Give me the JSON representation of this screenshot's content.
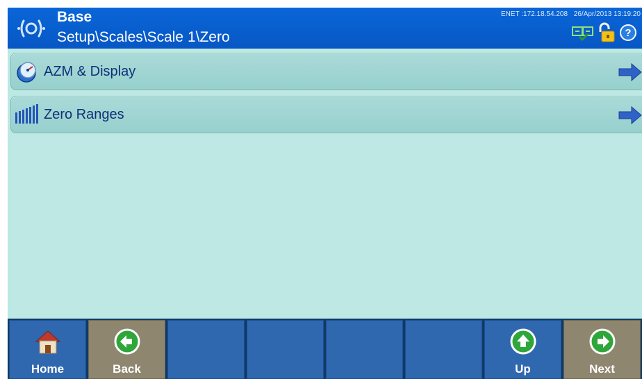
{
  "header": {
    "title": "Base",
    "path": "Setup\\Scales\\Scale 1\\Zero",
    "network": "ENET :172.18.54.208",
    "datetime": "26/Apr/2013 13:19:20",
    "icons": [
      "scale-status-icon",
      "unlock-icon",
      "help-icon"
    ]
  },
  "menu": {
    "items": [
      {
        "label": "AZM & Display",
        "icon": "azm-display-icon"
      },
      {
        "label": "Zero Ranges",
        "icon": "zero-ranges-icon"
      }
    ]
  },
  "softkeys": [
    {
      "label": "Home",
      "icon": "home-icon"
    },
    {
      "label": "Back",
      "icon": "back-arrow-icon"
    },
    {
      "label": ""
    },
    {
      "label": ""
    },
    {
      "label": ""
    },
    {
      "label": ""
    },
    {
      "label": "Up",
      "icon": "up-arrow-icon"
    },
    {
      "label": "Next",
      "icon": "next-arrow-icon"
    }
  ],
  "colors": {
    "header": "#0a66d8",
    "content": "#bde8e4",
    "menu_item": "#a9dad8",
    "softkey_blue": "#3068b0",
    "softkey_tan": "#8f8670",
    "softkey_circle": "#2fa63a"
  }
}
